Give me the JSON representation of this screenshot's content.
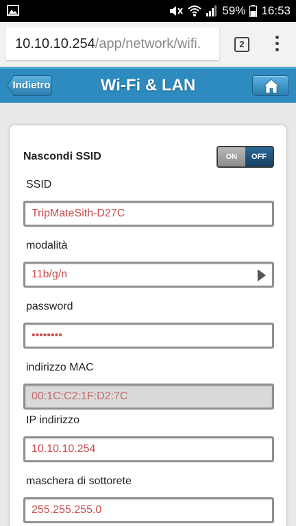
{
  "status_bar": {
    "battery_percent": "59%",
    "time": "16:53"
  },
  "browser": {
    "url_host": "10.10.10.254",
    "url_path": "/app/network/wifi.",
    "tab_count": "2"
  },
  "header": {
    "back_label": "Indietro",
    "title": "Wi-Fi & LAN"
  },
  "form": {
    "hide_ssid": {
      "label": "Nascondi SSID",
      "on_label": "ON",
      "off_label": "OFF",
      "state": "OFF"
    },
    "ssid": {
      "label": "SSID",
      "value": "TripMateSith-D27C"
    },
    "mode": {
      "label": "modalità",
      "value": "11b/g/n"
    },
    "password": {
      "label": "password",
      "value": "••••••••"
    },
    "mac": {
      "label": "indirizzo MAC",
      "value": "00:1C:C2:1F:D2:7C"
    },
    "ip": {
      "label": "IP indirizzo",
      "value": "10.10.10.254"
    },
    "subnet": {
      "label": "maschera di sottorete",
      "value": "255.255.255.0"
    }
  },
  "colors": {
    "header_bg": "#2e8bbf",
    "field_text": "#c94c4c",
    "toggle_off_bg": "#1d4f78"
  }
}
